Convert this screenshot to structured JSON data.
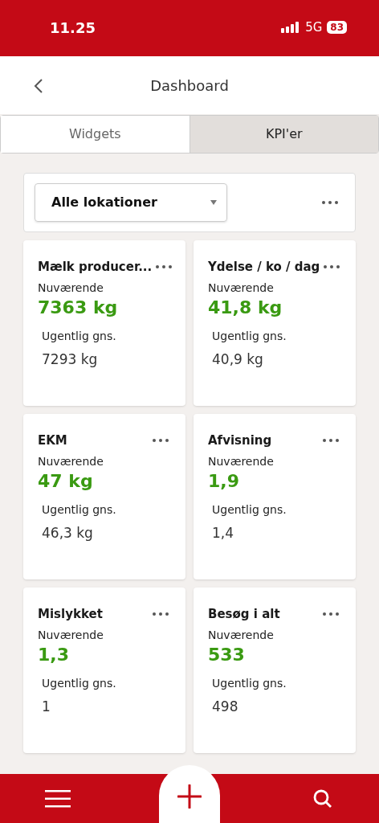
{
  "status_bar": {
    "time": "11.25",
    "network": "5G",
    "battery": "83"
  },
  "header": {
    "title": "Dashboard"
  },
  "tabs": [
    {
      "label": "Widgets",
      "selected": false
    },
    {
      "label": "KPI'er",
      "selected": true
    }
  ],
  "filter": {
    "location": "Alle lokationer"
  },
  "kpis": [
    {
      "title": "Mælk producer...",
      "current_label": "Nuværende",
      "current": "7363 kg",
      "weekly_label": "Ugentlig gns.",
      "weekly": "7293 kg"
    },
    {
      "title": "Ydelse / ko / dag",
      "current_label": "Nuværende",
      "current": "41,8 kg",
      "weekly_label": "Ugentlig gns.",
      "weekly": "40,9 kg"
    },
    {
      "title": "EKM",
      "current_label": "Nuværende",
      "current": "47 kg",
      "weekly_label": "Ugentlig gns.",
      "weekly": "46,3 kg"
    },
    {
      "title": "Afvisning",
      "current_label": "Nuværende",
      "current": "1,9",
      "weekly_label": "Ugentlig gns.",
      "weekly": "1,4"
    },
    {
      "title": "Mislykket",
      "current_label": "Nuværende",
      "current": "1,3",
      "weekly_label": "Ugentlig gns.",
      "weekly": "1"
    },
    {
      "title": "Besøg i alt",
      "current_label": "Nuværende",
      "current": "533",
      "weekly_label": "Ugentlig gns.",
      "weekly": "498"
    }
  ]
}
